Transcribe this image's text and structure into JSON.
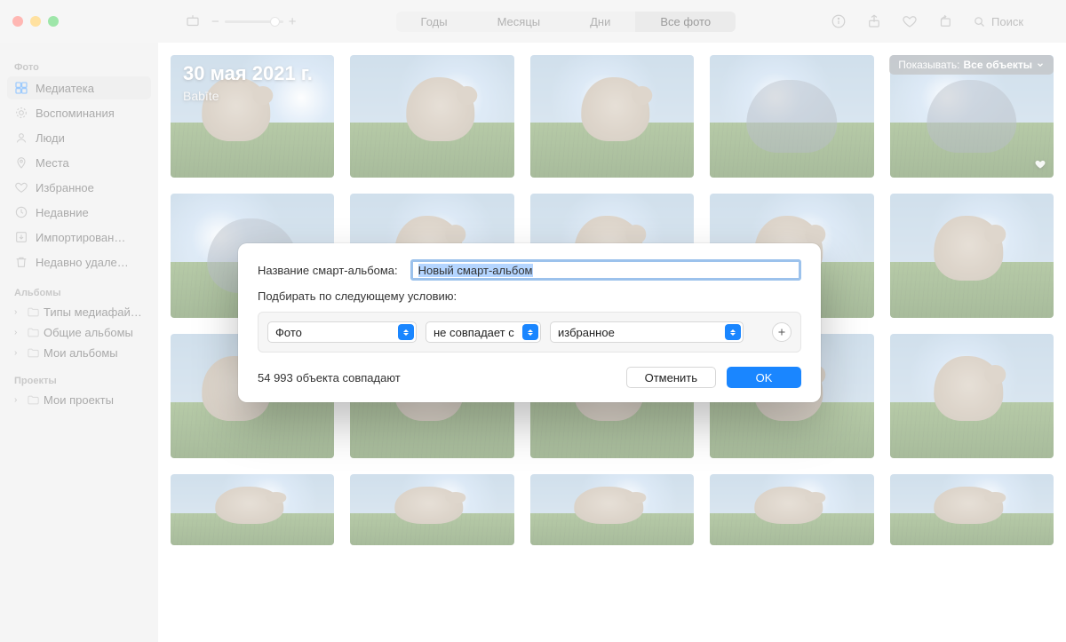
{
  "toolbar": {
    "zoom_minus": "−",
    "zoom_plus": "+",
    "segments": [
      "Годы",
      "Месяцы",
      "Дни",
      "Все фото"
    ],
    "selected_segment_index": 3,
    "search_placeholder": "Поиск"
  },
  "overlay": {
    "date": "30 мая 2021 г.",
    "place": "Babīte",
    "show_label": "Показывать:",
    "show_value": "Все объекты"
  },
  "sidebar": {
    "sections": {
      "photos": "Фото",
      "albums": "Альбомы",
      "projects": "Проекты"
    },
    "library": [
      {
        "id": "library",
        "label": "Медиатека",
        "icon": "photos",
        "selected": true
      },
      {
        "id": "memories",
        "label": "Воспоминания",
        "icon": "memories",
        "selected": false
      },
      {
        "id": "people",
        "label": "Люди",
        "icon": "people",
        "selected": false
      },
      {
        "id": "places",
        "label": "Места",
        "icon": "places",
        "selected": false
      },
      {
        "id": "favorites",
        "label": "Избранное",
        "icon": "heart",
        "selected": false
      },
      {
        "id": "recents",
        "label": "Недавние",
        "icon": "clock",
        "selected": false
      },
      {
        "id": "imports",
        "label": "Импортирован…",
        "icon": "import",
        "selected": false
      },
      {
        "id": "deleted",
        "label": "Недавно удале…",
        "icon": "trash",
        "selected": false
      }
    ],
    "albums": [
      {
        "id": "media-types",
        "label": "Типы медиафай…"
      },
      {
        "id": "shared-albums",
        "label": "Общие альбомы"
      },
      {
        "id": "my-albums",
        "label": "Мои альбомы"
      }
    ],
    "projects": [
      {
        "id": "my-projects",
        "label": "Мои проекты"
      }
    ]
  },
  "modal": {
    "name_label": "Название смарт-альбома:",
    "name_value": "Новый смарт-альбом",
    "condition_label": "Подбирать по следующему условию:",
    "criteria": {
      "field": "Фото",
      "operator": "не совпадает с",
      "value": "избранное"
    },
    "match_count": "54 993 объекта совпадают",
    "cancel": "Отменить",
    "ok": "OK"
  }
}
